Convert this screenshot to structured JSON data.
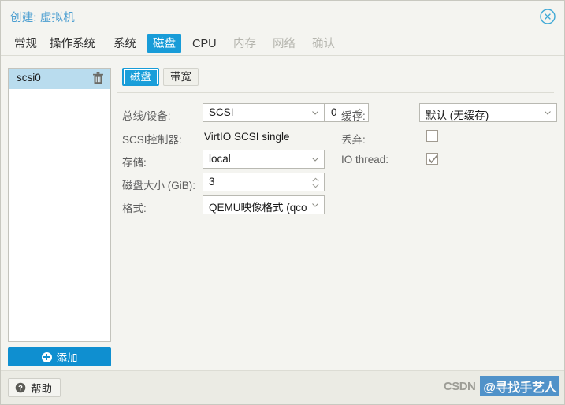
{
  "window": {
    "title": "创建: 虚拟机",
    "close_icon": "close-circle-icon"
  },
  "tabs": [
    {
      "label": "常规",
      "state": "enabled"
    },
    {
      "label": "操作系统",
      "state": "enabled"
    },
    {
      "label": "系统",
      "state": "enabled"
    },
    {
      "label": "磁盘",
      "state": "active"
    },
    {
      "label": "CPU",
      "state": "enabled"
    },
    {
      "label": "内存",
      "state": "disabled"
    },
    {
      "label": "网络",
      "state": "disabled"
    },
    {
      "label": "确认",
      "state": "disabled"
    }
  ],
  "device_list": {
    "items": [
      {
        "label": "scsi0",
        "selected": true,
        "delete_icon": "trash-icon"
      }
    ],
    "add_button": {
      "label": "添加",
      "icon": "plus-circle-icon"
    }
  },
  "subtabs": [
    {
      "label": "磁盘",
      "active": true
    },
    {
      "label": "带宽",
      "active": false
    }
  ],
  "form": {
    "left": {
      "bus_device": {
        "label": "总线/设备:",
        "bus_value": "SCSI",
        "index_value": "0"
      },
      "scsi_controller": {
        "label": "SCSI控制器:",
        "value": "VirtIO SCSI single"
      },
      "storage": {
        "label": "存储:",
        "value": "local"
      },
      "disk_size": {
        "label": "磁盘大小 (GiB):",
        "value": "3"
      },
      "format": {
        "label": "格式:",
        "value": "QEMU映像格式 (qco"
      }
    },
    "right": {
      "cache": {
        "label": "缓存:",
        "value": "默认 (无缓存)"
      },
      "discard": {
        "label": "丢弃:",
        "checked": false
      },
      "io_thread": {
        "label": "IO thread:",
        "checked": true
      }
    }
  },
  "footer": {
    "help_button": {
      "label": "帮助",
      "icon": "question-circle-icon"
    }
  },
  "watermark": {
    "brand": "CSDN",
    "user": "@寻找手艺人"
  },
  "colors": {
    "accent_blue": "#189cd8",
    "title_blue": "#4d9fd1",
    "selection_blue": "#b9dcee",
    "add_button_blue": "#0f8fd0",
    "panel_bg": "#f4f4f0",
    "footer_bg": "#ebebe4"
  }
}
